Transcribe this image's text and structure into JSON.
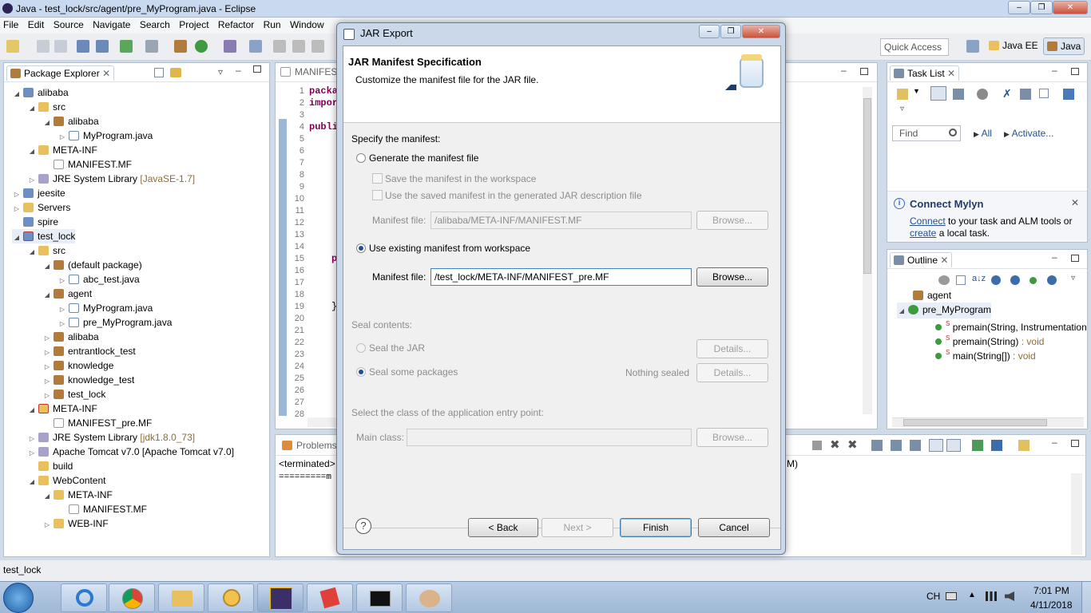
{
  "window": {
    "title": "Java - test_lock/src/agent/pre_MyProgram.java - Eclipse"
  },
  "menu": [
    "File",
    "Edit",
    "Source",
    "Navigate",
    "Search",
    "Project",
    "Refactor",
    "Run",
    "Window"
  ],
  "toolbar": {
    "quick_access_placeholder": "Quick Access",
    "perspectives": [
      "Java EE",
      "Java"
    ]
  },
  "package_explorer": {
    "title": "Package Explorer",
    "items": [
      {
        "label": "alibaba",
        "dec": ""
      },
      {
        "label": "src",
        "dec": ""
      },
      {
        "label": "alibaba",
        "dec": ""
      },
      {
        "label": "MyProgram.java",
        "dec": ""
      },
      {
        "label": "META-INF",
        "dec": ""
      },
      {
        "label": "MANIFEST.MF",
        "dec": ""
      },
      {
        "label": "JRE System Library",
        "dec": "[JavaSE-1.7]"
      },
      {
        "label": "jeesite",
        "dec": ""
      },
      {
        "label": "Servers",
        "dec": ""
      },
      {
        "label": "spire",
        "dec": ""
      },
      {
        "label": "test_lock",
        "dec": ""
      },
      {
        "label": "src",
        "dec": ""
      },
      {
        "label": "(default package)",
        "dec": ""
      },
      {
        "label": "abc_test.java",
        "dec": ""
      },
      {
        "label": "agent",
        "dec": ""
      },
      {
        "label": "MyProgram.java",
        "dec": ""
      },
      {
        "label": "pre_MyProgram.java",
        "dec": ""
      },
      {
        "label": "alibaba",
        "dec": ""
      },
      {
        "label": "entrantlock_test",
        "dec": ""
      },
      {
        "label": "knowledge",
        "dec": ""
      },
      {
        "label": "knowledge_test",
        "dec": ""
      },
      {
        "label": "test_lock",
        "dec": ""
      },
      {
        "label": "META-INF",
        "dec": ""
      },
      {
        "label": "MANIFEST_pre.MF",
        "dec": ""
      },
      {
        "label": "JRE System Library",
        "dec": "[jdk1.8.0_73]"
      },
      {
        "label": "Apache Tomcat v7.0 [Apache Tomcat v7.0]",
        "dec": ""
      },
      {
        "label": "build",
        "dec": ""
      },
      {
        "label": "WebContent",
        "dec": ""
      },
      {
        "label": "META-INF",
        "dec": ""
      },
      {
        "label": "MANIFEST.MF",
        "dec": ""
      },
      {
        "label": "WEB-INF",
        "dec": ""
      }
    ]
  },
  "editor": {
    "tab": "MANIFES",
    "line_numbers": [
      "1",
      "2",
      "3",
      "4",
      "5",
      "6",
      "7",
      "8",
      "9",
      "10",
      "11",
      "12",
      "13",
      "14",
      "15",
      "16",
      "17",
      "18",
      "19",
      "20",
      "21",
      "22",
      "23",
      "24",
      "25",
      "26",
      "27",
      "28"
    ],
    "code": {
      "l1": "packa",
      "l2": "impor",
      "l4": "publi",
      "l15": "p",
      "l19": "}"
    }
  },
  "console": {
    "tab": "Problems",
    "terminated": "<terminated>",
    "terminated_tail": "M)",
    "output": "=========m"
  },
  "task_list": {
    "title": "Task List",
    "find_placeholder": "Find",
    "all": "All",
    "activate": "Activate..."
  },
  "connect_mylyn": {
    "title": "Connect Mylyn",
    "link1": "Connect",
    "text1": " to your task and ALM tools or",
    "link2": "create",
    "text2": " a local task."
  },
  "outline": {
    "title": "Outline",
    "items": [
      {
        "label": "agent",
        "type": ""
      },
      {
        "label": "pre_MyProgram",
        "type": ""
      },
      {
        "label": "premain(String, Instrumentation",
        "type": ""
      },
      {
        "label": "premain(String)",
        "type": " : void"
      },
      {
        "label": "main(String[])",
        "type": " : void"
      }
    ]
  },
  "dialog": {
    "title": "JAR Export",
    "header_title": "JAR Manifest Specification",
    "header_desc": "Customize the manifest file for the JAR file.",
    "specify_label": "Specify the manifest:",
    "generate_radio": "Generate the manifest file",
    "save_checkbox": "Save the manifest in the workspace",
    "use_saved_checkbox": "Use the saved manifest in the generated JAR description file",
    "manifest_file_label": "Manifest file:",
    "generated_manifest_value": "/alibaba/META-INF/MANIFEST.MF",
    "browse_label": "Browse...",
    "use_existing_radio": "Use existing manifest from workspace",
    "existing_manifest_value": "/test_lock/META-INF/MANIFEST_pre.MF",
    "seal_contents_label": "Seal contents:",
    "seal_jar_radio": "Seal the JAR",
    "seal_packages_radio": "Seal some packages",
    "nothing_sealed": "Nothing sealed",
    "details_label": "Details...",
    "entry_point_label": "Select the class of the application entry point:",
    "main_class_label": "Main class:",
    "main_class_value": "",
    "back_button": "< Back",
    "next_button": "Next >",
    "finish_button": "Finish",
    "cancel_button": "Cancel",
    "help": "?"
  },
  "status_bar": {
    "text": "test_lock"
  },
  "taskbar": {
    "apps": [
      "Internet Explorer",
      "Chrome",
      "Explorer",
      "Outlook",
      "Java EE IDE",
      "Paint",
      "Command Prompt",
      "Palette"
    ],
    "lang": "CH",
    "time": "7:01 PM",
    "date": "4/11/2018"
  }
}
